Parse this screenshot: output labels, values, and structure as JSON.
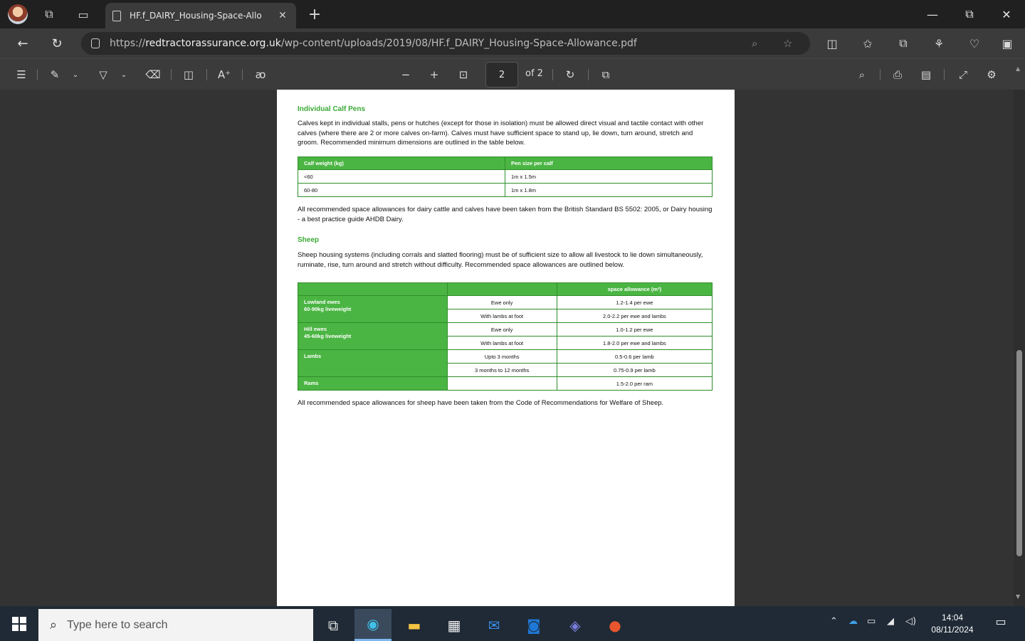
{
  "browser": {
    "tab_title": "HF.f_DAIRY_Housing-Space-Allo",
    "url_prefix": "https://",
    "url_domain": "redtractorassurance.org.uk",
    "url_path": "/wp-content/uploads/2019/08/HF.f_DAIRY_Housing-Space-Allowance.pdf",
    "tab_close": "✕",
    "new_tab": "+",
    "minimize": "—",
    "restore": "⧉",
    "close": "✕"
  },
  "pdf_toolbar": {
    "current_page": "2",
    "page_count": "of 2"
  },
  "document": {
    "calf_heading": "Individual Calf Pens",
    "calf_text": "Calves kept in individual stalls, pens or hutches (except for those in isolation) must be allowed direct visual and tactile contact with other calves (where there are 2 or more calves on-farm). Calves must have sufficient space to stand up, lie down, turn around, stretch and groom. Recommended minimum dimensions are outlined in the table below.",
    "calf_table": {
      "headers": [
        "Calf weight (kg)",
        "Pen size per calf"
      ],
      "rows": [
        [
          "<60",
          "1m x 1.5m"
        ],
        [
          "60-80",
          "1m x 1.8m"
        ]
      ]
    },
    "calf_note": "All recommended space allowances for dairy cattle and calves have been taken from the British Standard BS 5502: 2005, or Dairy housing - a best practice guide AHDB Dairy.",
    "sheep_heading": "Sheep",
    "sheep_text": "Sheep housing systems (including corrals and slatted flooring) must be of sufficient size to allow all livestock to lie down simultaneously, ruminate, rise, turn around and stretch without difficulty. Recommended space allowances are outlined below.",
    "sheep_table": {
      "header_allowance": "space allowance (m²)",
      "groups": [
        {
          "label_line1": "Lowland ewes",
          "label_line2": "60-90kg liveweight",
          "rows": [
            [
              "Ewe only",
              "1.2-1.4 per ewe"
            ],
            [
              "With lambs at foot",
              "2.0-2.2 per ewe and lambs"
            ]
          ]
        },
        {
          "label_line1": "Hill ewes",
          "label_line2": "45-60kg liveweight",
          "rows": [
            [
              "Ewe only",
              "1.0-1.2 per ewe"
            ],
            [
              "With lambs at foot",
              "1.8-2.0 per ewe and lambs"
            ]
          ]
        },
        {
          "label_line1": "Lambs",
          "label_line2": "",
          "rows": [
            [
              "Upto 3 months",
              "0.5-0.6 per lamb"
            ],
            [
              "3 months to 12 months",
              "0.75-0.9 per lamb"
            ]
          ]
        },
        {
          "label_line1": "Rams",
          "label_line2": "",
          "rows": [
            [
              "",
              "1.5-2.0 per ram"
            ]
          ]
        }
      ]
    },
    "sheep_note": "All recommended space allowances for sheep have been taken from the Code of Recommendations for Welfare of Sheep."
  },
  "taskbar": {
    "search_placeholder": "Type here to search",
    "time": "14:04",
    "date": "08/11/2024"
  },
  "colors": {
    "accent_green": "#4bb543",
    "heading_green": "#3aa935",
    "taskbar": "#1f2a36"
  }
}
